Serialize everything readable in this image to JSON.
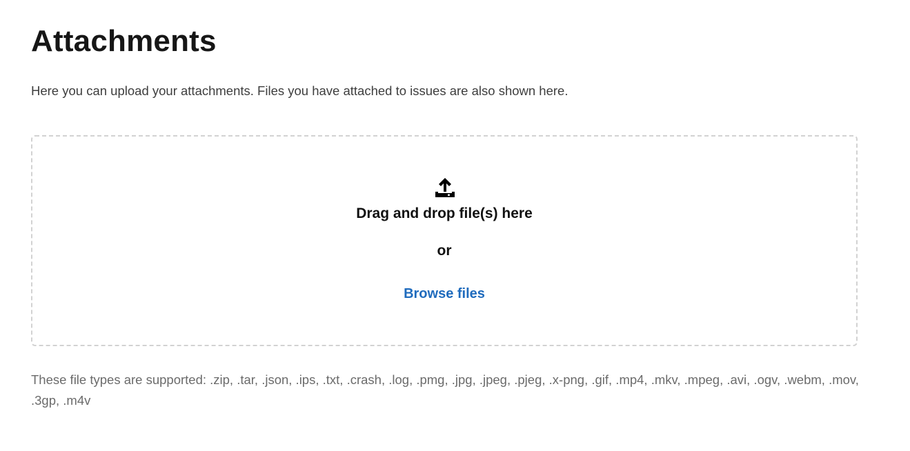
{
  "page": {
    "title": "Attachments",
    "description": "Here you can upload your attachments. Files you have attached to issues are also shown here."
  },
  "dropzone": {
    "icon": "upload-icon",
    "drop_label": "Drag and drop file(s) here",
    "or_label": "or",
    "browse_label": "Browse files"
  },
  "supported_types_text": "These file types are supported: .zip, .tar, .json, .ips, .txt, .crash, .log, .pmg, .jpg, .jpeg, .pjeg, .x-png, .gif, .mp4, .mkv, .mpeg, .avi, .ogv, .webm, .mov, .3gp, .m4v",
  "colors": {
    "link": "#1f6bbd",
    "title": "#161616",
    "muted_text": "#6b6b6b",
    "dropzone_border": "#d2d2d2"
  }
}
